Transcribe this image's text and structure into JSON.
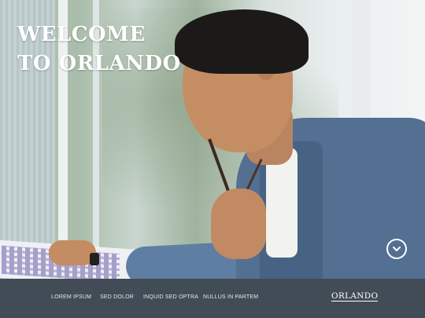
{
  "hero": {
    "title_line1": "WELCOME",
    "title_line2": "TO ORLANDO",
    "scroll_icon": "chevron-down-circle-icon"
  },
  "nav": {
    "items": [
      {
        "label": "LOREM IPSUM"
      },
      {
        "label": "SED DOLOR"
      },
      {
        "label": "INQUID SED OPTRA"
      },
      {
        "label": "NULLUS IN PARTEM"
      }
    ],
    "brand": "ORLANDO"
  },
  "colors": {
    "navbar_bg": "#414c56",
    "title_text": "#ffffff"
  }
}
